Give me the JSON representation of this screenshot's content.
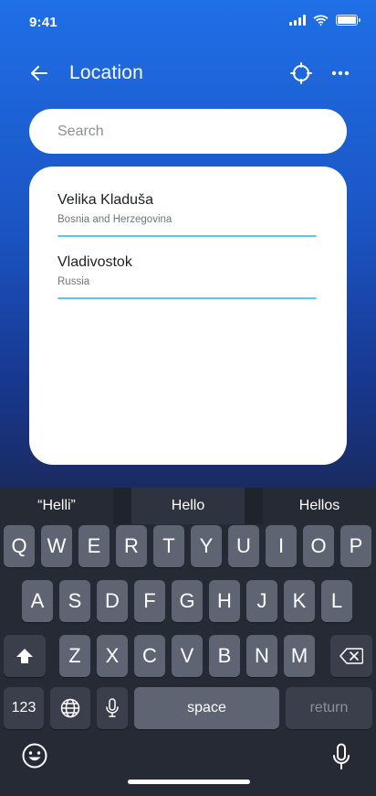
{
  "status_bar": {
    "time": "9:41"
  },
  "header": {
    "title": "Location"
  },
  "search": {
    "placeholder": "Search",
    "value": ""
  },
  "results": [
    {
      "city": "Velika Kladuša",
      "country": "Bosnia and Herzegovina"
    },
    {
      "city": "Vladivostok",
      "country": "Russia"
    }
  ],
  "keyboard": {
    "suggestions": [
      "“Helli”",
      "Hello",
      "Hellos"
    ],
    "row1": [
      "Q",
      "W",
      "E",
      "R",
      "T",
      "Y",
      "U",
      "I",
      "O",
      "P"
    ],
    "row2": [
      "A",
      "S",
      "D",
      "F",
      "G",
      "H",
      "J",
      "K",
      "L"
    ],
    "row3": [
      "Z",
      "X",
      "C",
      "V",
      "B",
      "N",
      "M"
    ],
    "numbers_label": "123",
    "space_label": "space",
    "return_label": "return"
  },
  "colors": {
    "gradient_top": "#1f6fe6",
    "gradient_bottom": "#1c2340",
    "divider": "#5bc8ec",
    "key": "#5f6472",
    "key_dark": "#3b3f4b"
  }
}
